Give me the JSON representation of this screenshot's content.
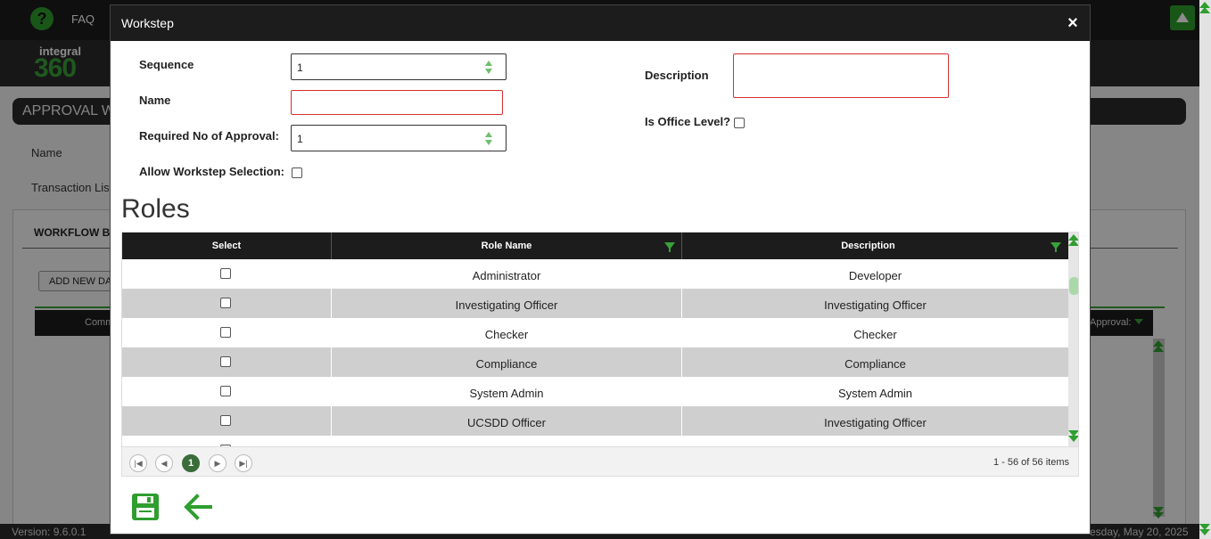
{
  "background": {
    "topbar": {
      "faq_label": "FAQ",
      "help_icon": "question-icon",
      "scroll_top_icon": "arrow-up-icon"
    },
    "logo": {
      "line1": "integral",
      "line2": "360"
    },
    "page_title": "APPROVAL W",
    "form_labels": {
      "name": "Name",
      "transaction_list": "Transaction List"
    },
    "panel": {
      "section_title": "WORKFLOW BR",
      "add_button": "ADD NEW DA",
      "grid_header_left": "Comm",
      "grid_header_right": "Approval:"
    },
    "footer": {
      "version": "Version: 9.6.0.1",
      "date": "esday, May 20, 2025"
    }
  },
  "modal": {
    "title": "Workstep",
    "close_icon": "close-icon",
    "fields": {
      "sequence": {
        "label": "Sequence",
        "value": "1"
      },
      "name": {
        "label": "Name",
        "value": ""
      },
      "required_approval": {
        "label": "Required No of Approval:",
        "value": "1"
      },
      "allow_selection": {
        "label": "Allow Workstep Selection:"
      },
      "description": {
        "label": "Description",
        "value": ""
      },
      "office_level": {
        "label": "Is Office Level?"
      }
    },
    "roles": {
      "heading": "Roles",
      "columns": {
        "select": "Select",
        "role_name": "Role Name",
        "description": "Description"
      },
      "rows": [
        {
          "role_name": "Administrator",
          "description": "Developer"
        },
        {
          "role_name": "Investigating Officer",
          "description": "Investigating Officer"
        },
        {
          "role_name": "Checker",
          "description": "Checker"
        },
        {
          "role_name": "Compliance",
          "description": "Compliance"
        },
        {
          "role_name": "System Admin",
          "description": "System Admin"
        },
        {
          "role_name": "UCSDD Officer",
          "description": "Investigating Officer"
        }
      ],
      "pager": {
        "current_page": "1",
        "info": "1 - 56 of 56 items"
      }
    },
    "actions": {
      "save_icon": "save-icon",
      "back_icon": "arrow-left-icon"
    }
  },
  "colors": {
    "accent": "#2e9e2e",
    "header_dark": "#1c1c1c",
    "error_border": "#d32f2f",
    "row_alt": "#cfcfcf"
  }
}
